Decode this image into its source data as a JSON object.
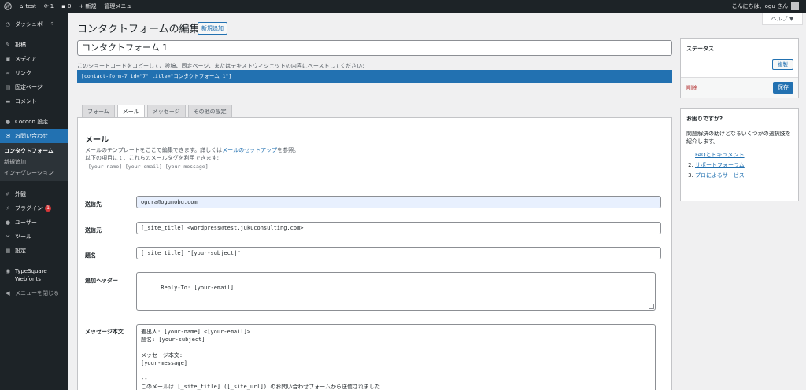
{
  "adminbar": {
    "site_name": "test",
    "updates": "1",
    "comments": "0",
    "new_label": "新規",
    "admin_menu": "管理メニュー",
    "greeting": "こんにちは、ogu さん"
  },
  "sidebar": {
    "items": [
      {
        "label": "ダッシュボード",
        "icon": "dashboard-icon"
      },
      {
        "label": "投稿",
        "icon": "pin-icon"
      },
      {
        "label": "メディア",
        "icon": "media-icon"
      },
      {
        "label": "リンク",
        "icon": "link-icon"
      },
      {
        "label": "固定ページ",
        "icon": "page-icon"
      },
      {
        "label": "コメント",
        "icon": "comment-icon"
      },
      {
        "label": "Cocoon 設定",
        "icon": "cocoon-icon"
      },
      {
        "label": "お問い合わせ",
        "icon": "mail-icon"
      },
      {
        "label": "外観",
        "icon": "brush-icon"
      },
      {
        "label": "プラグイン",
        "icon": "plugin-icon",
        "badge": "1"
      },
      {
        "label": "ユーザー",
        "icon": "user-icon"
      },
      {
        "label": "ツール",
        "icon": "wrench-icon"
      },
      {
        "label": "設定",
        "icon": "settings-icon"
      },
      {
        "label": "TypeSquare Webfonts",
        "icon": "typesquare-icon"
      },
      {
        "label": "メニューを閉じる",
        "icon": "collapse-icon"
      }
    ],
    "submenu": [
      "コンタクトフォーム",
      "新規追加",
      "インテグレーション"
    ]
  },
  "header": {
    "help": "ヘルプ ▼",
    "title": "コンタクトフォームの編集",
    "add_new": "新規追加"
  },
  "form": {
    "title_value": "コンタクトフォーム 1",
    "shortcode_hint": "このショートコードをコピーして、投稿、固定ページ、またはテキストウィジェットの内容にペーストしてください:",
    "shortcode": "[contact-form-7 id=\"7\" title=\"コンタクトフォーム 1\"]"
  },
  "tabs": [
    "フォーム",
    "メール",
    "メッセージ",
    "その他の設定"
  ],
  "mail": {
    "heading": "メール",
    "desc1_pre": "メールのテンプレートをここで編集できます。詳しくは",
    "desc1_link": "メールのセットアップ",
    "desc1_post": "を参照。",
    "desc2": "以下の項目にて、これらのメールタグを利用できます:",
    "mailtags": "[your-name] [your-email] [your-message]",
    "to_label": "送信先",
    "to_value": "ogura@ogunobu.com",
    "from_label": "送信元",
    "from_value": "[_site_title] <wordpress@test.jukuconsulting.com>",
    "subject_label": "題名",
    "subject_value": "[_site_title] \"[your-subject]\"",
    "headers_label": "追加ヘッダー",
    "headers_value": "Reply-To: [your-email]",
    "body_label": "メッセージ本文",
    "body_value": "差出人: [your-name] <[your-email]>\n題名: [your-subject]\n\nメッセージ本文:\n[your-message]\n\n--\nこのメールは [_site_title] ([_site_url]) のお問い合わせフォームから送信されました"
  },
  "status": {
    "title": "ステータス",
    "duplicate": "複製",
    "delete": "削除",
    "save": "保存"
  },
  "help_box": {
    "title": "お困りですか?",
    "text": "問題解決の助けとなるいくつかの選択肢を紹介します。",
    "links": [
      "FAQとドキュメント",
      "サポートフォーラム",
      "プロによるサービス"
    ]
  }
}
